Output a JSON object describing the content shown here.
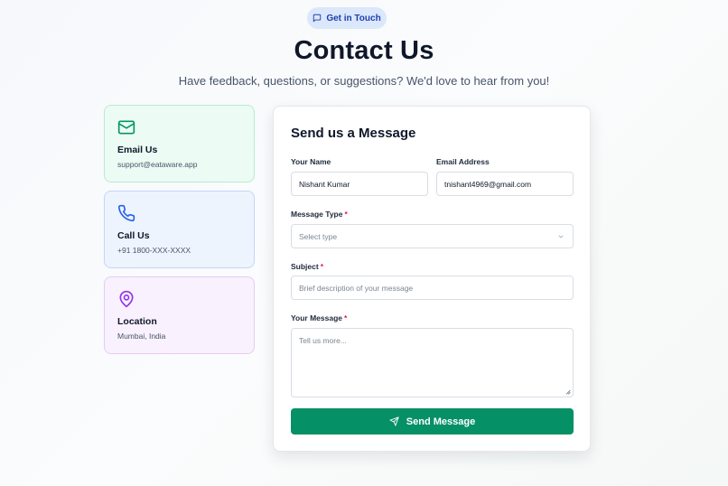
{
  "badge": {
    "label": "Get in Touch",
    "icon": "message-square-icon"
  },
  "header": {
    "title": "Contact Us",
    "subtitle": "Have feedback, questions, or suggestions? We'd love to hear from you!"
  },
  "contact_cards": [
    {
      "title": "Email Us",
      "value": "support@eataware.app",
      "icon": "mail-icon",
      "color": "#059669"
    },
    {
      "title": "Call Us",
      "value": "+91 1800-XXX-XXXX",
      "icon": "phone-icon",
      "color": "#2563eb"
    },
    {
      "title": "Location",
      "value": "Mumbai, India",
      "icon": "map-pin-icon",
      "color": "#9333ea"
    }
  ],
  "form": {
    "title": "Send us a Message",
    "name": {
      "label": "Your Name",
      "value": "Nishant Kumar"
    },
    "email": {
      "label": "Email Address",
      "value": "tnishant4969@gmail.com"
    },
    "message_type": {
      "label": "Message Type",
      "required_mark": "*",
      "placeholder": "Select type"
    },
    "subject": {
      "label": "Subject",
      "required_mark": "*",
      "placeholder": "Brief description of your message"
    },
    "message": {
      "label": "Your Message",
      "required_mark": "*",
      "placeholder": "Tell us more..."
    },
    "submit_label": "Send Message"
  },
  "colors": {
    "accent": "#069066",
    "badge_bg": "#dbe7fb",
    "badge_text": "#1e40af",
    "required": "#e11d48"
  }
}
